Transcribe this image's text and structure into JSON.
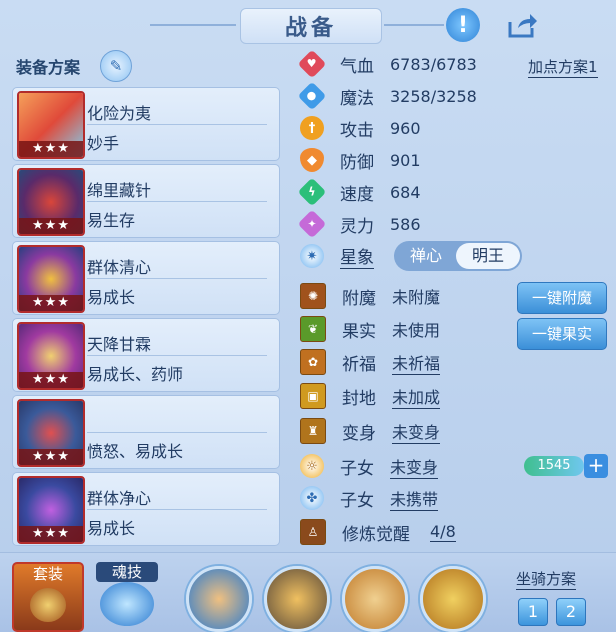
{
  "header": {
    "title": "战备"
  },
  "plans": {
    "label": "装备方案",
    "items": [
      {
        "name": "化险为夷",
        "sub": "妙手",
        "stars": "★★★"
      },
      {
        "name": "绵里藏针",
        "sub": "易生存",
        "stars": "★★★"
      },
      {
        "name": "群体清心",
        "sub": "易成长",
        "stars": "★★★"
      },
      {
        "name": "天降甘霖",
        "sub": "易成长、药师",
        "stars": "★★★"
      },
      {
        "name": "",
        "sub": "愤怒、易成长",
        "stars": "★★★"
      },
      {
        "name": "群体净心",
        "sub": "易成长",
        "stars": "★★★"
      }
    ]
  },
  "stats": {
    "points_plan": "加点方案1",
    "rows": [
      {
        "label": "气血",
        "value": "6783/6783",
        "color": "#e04a5a"
      },
      {
        "label": "魔法",
        "value": "3258/3258",
        "color": "#3f9be8"
      },
      {
        "label": "攻击",
        "value": "960",
        "color": "#f0a020"
      },
      {
        "label": "防御",
        "value": "901",
        "color": "#f08a30"
      },
      {
        "label": "速度",
        "value": "684",
        "color": "#2bbf7a"
      },
      {
        "label": "灵力",
        "value": "586",
        "color": "#c56ad8"
      }
    ]
  },
  "xingxiang": {
    "label": "星象",
    "option_a": "禅心",
    "option_b": "明王"
  },
  "enhance": {
    "rows": [
      {
        "label": "附魔",
        "value": "未附魔"
      },
      {
        "label": "果实",
        "value": "未使用"
      },
      {
        "label": "祈福",
        "value": "未祈福"
      },
      {
        "label": "封地",
        "value": "未加成"
      },
      {
        "label": "变身",
        "value": "未变身"
      },
      {
        "label": "子女",
        "value": "未变身"
      },
      {
        "label": "子女",
        "value": "未携带"
      },
      {
        "label": "修炼觉醒",
        "value": "4/8"
      }
    ],
    "btn_enchant": "一键附魔",
    "btn_fruit": "一键果实",
    "currency": "1545"
  },
  "bottom": {
    "set_label": "套装",
    "soul_label": "魂技",
    "mount_label": "坐骑方案",
    "mount_1": "1",
    "mount_2": "2"
  }
}
